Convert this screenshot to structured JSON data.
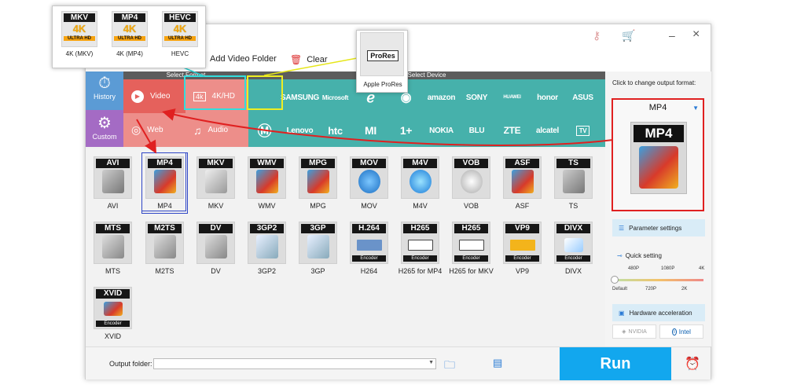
{
  "window": {
    "titlebar_icons": [
      "key-icon",
      "cart-icon"
    ],
    "minimize": "–",
    "close": "×"
  },
  "toolbar": {
    "add_video_folder": "Add Video Folder",
    "clear": "Clear"
  },
  "headers": {
    "select_format": "Select Format",
    "select_device": "Select Device"
  },
  "sidebar": {
    "history": "History",
    "custom": "Custom"
  },
  "categories": {
    "video": "Video",
    "hd": "4K/HD",
    "web": "Web",
    "audio": "Audio"
  },
  "devices_row1": [
    "",
    "SAMSUNG",
    "Microsoft",
    "",
    "",
    "amazon",
    "SONY",
    "HUAWEI",
    "honor",
    "ASUS"
  ],
  "devices_row2": [
    "",
    "Lenovo",
    "htc",
    "MI",
    "1+",
    "NOKIA",
    "BLU",
    "ZTE",
    "alcatel",
    "TV"
  ],
  "formats_row1": [
    "AVI",
    "MP4",
    "MKV",
    "WMV",
    "MPG",
    "MOV",
    "M4V",
    "VOB",
    "ASF",
    "TS"
  ],
  "formats_row2": [
    {
      "band": "MTS",
      "label": "MTS",
      "enc": ""
    },
    {
      "band": "M2TS",
      "label": "M2TS",
      "enc": ""
    },
    {
      "band": "DV",
      "label": "DV",
      "enc": ""
    },
    {
      "band": "3GP2",
      "label": "3GP2",
      "enc": ""
    },
    {
      "band": "3GP",
      "label": "3GP",
      "enc": ""
    },
    {
      "band": "H.264",
      "label": "H264",
      "enc": "Encoder"
    },
    {
      "band": "H265",
      "label": "H265 for MP4",
      "enc": "Encoder"
    },
    {
      "band": "H265",
      "label": "H265 for MKV",
      "enc": "Encoder"
    },
    {
      "band": "VP9",
      "label": "VP9",
      "enc": "Encoder"
    },
    {
      "band": "DIVX",
      "label": "DIVX",
      "enc": "Encoder"
    }
  ],
  "formats_row3": [
    {
      "band": "XVID",
      "label": "XVID",
      "enc": "Encoder"
    }
  ],
  "right_panel": {
    "hint": "Click to change output format:",
    "selected_format": "MP4",
    "parameter_settings": "Parameter settings",
    "quick_setting": "Quick setting",
    "quality_top": [
      "480P",
      "1080P",
      "4K"
    ],
    "quality_bottom": [
      "Default",
      "720P",
      "2K"
    ],
    "quality_level": 0,
    "hardware_acceleration": "Hardware acceleration",
    "nvidia": "NVIDIA",
    "intel": "Intel"
  },
  "bottom": {
    "output_folder_label": "Output folder:",
    "output_folder_value": "",
    "run": "Run"
  },
  "popup_4k": [
    {
      "top": "MKV",
      "badge": "4K",
      "sub": "ULTRA HD",
      "label": "4K (MKV)"
    },
    {
      "top": "MP4",
      "badge": "4K",
      "sub": "ULTRA HD",
      "label": "4K (MP4)"
    },
    {
      "top": "HEVC",
      "badge": "4K",
      "sub": "ULTRA HD",
      "label": "HEVC"
    }
  ],
  "popup_apple": {
    "badge": "ProRes",
    "label": "Apple ProRes"
  },
  "colors": {
    "video_cat": "#e5615c",
    "history_btn": "#5b9bd5",
    "custom_btn": "#a46bc4",
    "device_teal": "#46b1ab",
    "run_blue": "#12a7ee",
    "highlight_red": "#e02020",
    "highlight_yellow": "#eeee22",
    "highlight_cyan": "#33dddd"
  }
}
